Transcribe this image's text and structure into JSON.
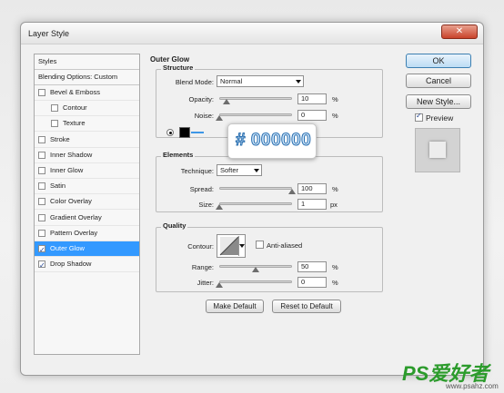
{
  "window": {
    "title": "Layer Style",
    "close_symbol": "✕"
  },
  "styles_panel": {
    "header": "Styles",
    "blending": "Blending Options: Custom",
    "items": [
      {
        "label": "Bevel & Emboss",
        "checked": false
      },
      {
        "label": "Contour",
        "checked": false
      },
      {
        "label": "Texture",
        "checked": false
      },
      {
        "label": "Stroke",
        "checked": false
      },
      {
        "label": "Inner Shadow",
        "checked": false
      },
      {
        "label": "Inner Glow",
        "checked": false
      },
      {
        "label": "Satin",
        "checked": false
      },
      {
        "label": "Color Overlay",
        "checked": false
      },
      {
        "label": "Gradient Overlay",
        "checked": false
      },
      {
        "label": "Pattern Overlay",
        "checked": false
      },
      {
        "label": "Outer Glow",
        "checked": true,
        "selected": true
      },
      {
        "label": "Drop Shadow",
        "checked": true
      }
    ]
  },
  "outer_glow": {
    "title": "Outer Glow",
    "structure": {
      "title": "Structure",
      "blend_mode_label": "Blend Mode:",
      "blend_mode_value": "Normal",
      "opacity_label": "Opacity:",
      "opacity_value": "10",
      "opacity_percent": 10,
      "noise_label": "Noise:",
      "noise_value": "0",
      "noise_percent": 0,
      "glow_color": "#000000"
    },
    "elements": {
      "title": "Elements",
      "technique_label": "Technique:",
      "technique_value": "Softer",
      "spread_label": "Spread:",
      "spread_value": "100",
      "spread_percent": 100,
      "size_label": "Size:",
      "size_value": "1",
      "size_unit": "px"
    },
    "quality": {
      "title": "Quality",
      "contour_label": "Contour:",
      "anti_aliased_label": "Anti-aliased",
      "range_label": "Range:",
      "range_value": "50",
      "range_percent": 50,
      "jitter_label": "Jitter:",
      "jitter_value": "0",
      "jitter_percent": 0
    },
    "percent_symbol": "%",
    "make_default": "Make Default",
    "reset_default": "Reset to Default"
  },
  "actions": {
    "ok": "OK",
    "cancel": "Cancel",
    "new_style": "New Style...",
    "preview_label": "Preview",
    "preview_checked": true
  },
  "callout": {
    "text": "# 000000"
  },
  "watermark": {
    "text": "PS爱好者",
    "url": "www.psahz.com"
  },
  "colors": {
    "selection": "#3399ff",
    "callout_text": "#3d96e6",
    "close_button": "#c9422a",
    "watermark_green": "#2c9b2c"
  }
}
